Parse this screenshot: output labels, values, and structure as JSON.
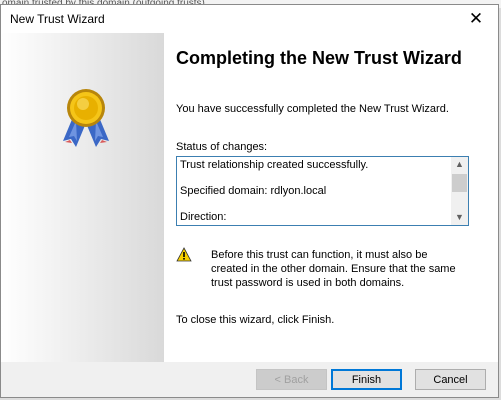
{
  "background_text": "omain trusted by this domain (outgoing trusts).",
  "window": {
    "title": "New Trust Wizard",
    "close_glyph": "✕"
  },
  "wizard": {
    "heading": "Completing the New Trust Wizard",
    "success_message": "You have successfully completed the New Trust Wizard.",
    "status_label": "Status of changes:",
    "status_lines": [
      "Trust relationship created successfully.",
      "Specified domain: rdlyon.local",
      "Direction:"
    ],
    "warning_message": "Before this trust can function, it must also be created in the other domain. Ensure that the same trust password is used in both domains.",
    "close_message": "To close this wizard, click Finish."
  },
  "buttons": {
    "back": "< Back",
    "finish": "Finish",
    "cancel": "Cancel"
  },
  "colors": {
    "accent": "#0078d7",
    "status_border": "#3c7fb1",
    "warning_yellow": "#f7d000"
  }
}
